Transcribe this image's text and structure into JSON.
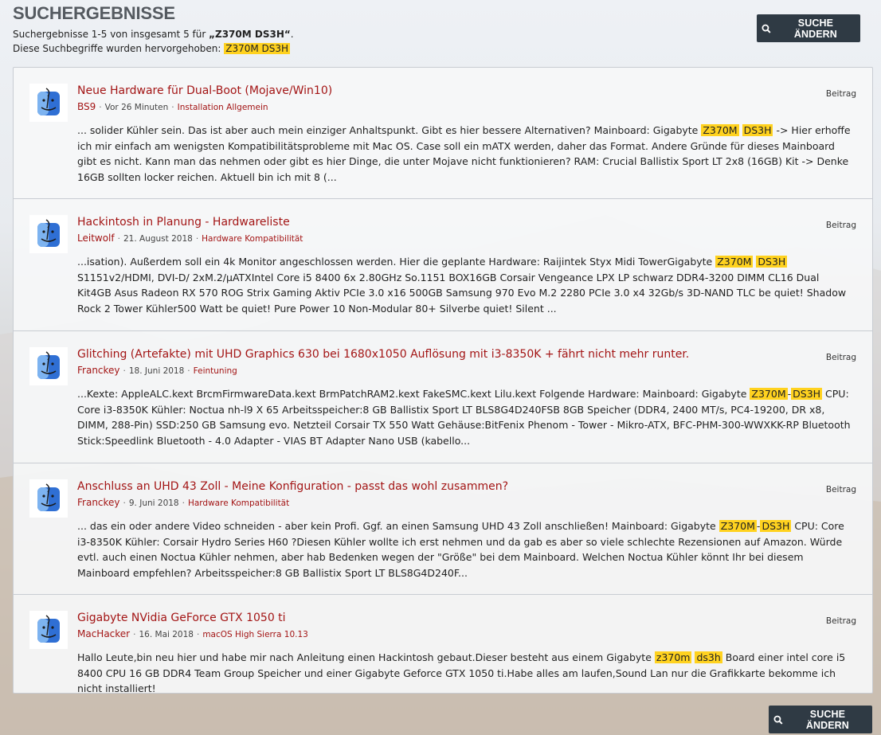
{
  "header": {
    "title": "SUCHERGEBNISSE",
    "summary_prefix": "Suchergebnisse 1-5 von insgesamt 5 für ",
    "query": "„Z370M DS3H“",
    "summary_suffix": ".",
    "highlight_label": "Diese Suchbegriffe wurden hervorgehoben: ",
    "highlight_term": "Z370M DS3H"
  },
  "buttons": {
    "change_search": "SUCHE ÄNDERN"
  },
  "results": [
    {
      "title": "Neue Hardware für Dual-Boot (Mojave/Win10)",
      "author": "BS9",
      "date": "Vor 26 Minuten",
      "forum": "Installation Allgemein",
      "type": "Beitrag",
      "snippet": [
        {
          "t": "... solider Kühler sein. Das ist aber auch mein einziger Anhaltspunkt. Gibt es hier bessere Alternativen? Mainboard: Gigabyte "
        },
        {
          "t": "Z370M",
          "hl": true
        },
        {
          "t": " "
        },
        {
          "t": "DS3H",
          "hl": true
        },
        {
          "t": " -> Hier erhoffe ich mir einfach am wenigsten Kompatibilitätsprobleme mit Mac OS. Case soll ein mATX werden, daher das Format. Andere Gründe für dieses Mainboard gibt es nicht. Kann man das nehmen oder gibt es hier Dinge, die unter Mojave nicht funktionieren? RAM: Crucial Ballistix Sport LT 2x8 (16GB) Kit -> Denke 16GB sollten locker reichen. Aktuell bin ich mit 8 (..."
        }
      ]
    },
    {
      "title": "Hackintosh in Planung - Hardwareliste",
      "author": "Leitwolf",
      "date": "21. August 2018",
      "forum": "Hardware Kompatibilität",
      "type": "Beitrag",
      "snippet": [
        {
          "t": "...isation). Außerdem soll ein 4k Monitor angeschlossen werden. Hier die geplante Hardware: Raijintek Styx Midi TowerGigabyte "
        },
        {
          "t": "Z370M",
          "hl": true
        },
        {
          "t": " "
        },
        {
          "t": "DS3H",
          "hl": true
        },
        {
          "t": " S1151v2/HDMI, DVI-D/ 2xM.2/µATXIntel Core i5 8400 6x 2.80GHz So.1151 BOX16GB Corsair Vengeance LPX LP schwarz DDR4-3200 DIMM CL16 Dual Kit4GB Asus Radeon RX 570 ROG Strix Gaming Aktiv PCIe 3.0 x16 500GB Samsung 970 Evo M.2 2280 PCIe 3.0 x4 32Gb/s 3D-NAND TLC be quiet! Shadow Rock 2 Tower Kühler500 Watt be quiet! Pure Power 10 Non-Modular 80+ Silverbe quiet! Silent ..."
        }
      ]
    },
    {
      "title": "Glitching (Artefakte) mit UHD Graphics 630 bei 1680x1050 Auflösung mit i3-8350K + fährt nicht mehr runter.",
      "author": "Franckey",
      "date": "18. Juni 2018",
      "forum": "Feintuning",
      "type": "Beitrag",
      "snippet": [
        {
          "t": "...Kexte: AppleALC.kext BrcmFirmwareData.kext BrmPatchRAM2.kext FakeSMC.kext Lilu.kext Folgende Hardware: Mainboard: Gigabyte "
        },
        {
          "t": "Z370M",
          "hl": true
        },
        {
          "t": "-"
        },
        {
          "t": "DS3H",
          "hl": true
        },
        {
          "t": " CPU: Core i3-8350K Kühler: Noctua nh-l9 X 65 Arbeitsspeicher:8 GB Ballistix Sport LT BLS8G4D240FSB 8GB Speicher (DDR4, 2400 MT/s, PC4-19200, DR x8, DIMM, 288-Pin) SSD:250 GB Samsung evo. Netzteil Corsair TX 550 Watt Gehäuse:BitFenix Phenom - Tower - Mikro-ATX, BFC-PHM-300-WWXKK-RP Bluetooth Stick:Speedlink Bluetooth - 4.0 Adapter - VIAS BT Adapter Nano USB (kabello..."
        }
      ]
    },
    {
      "title": "Anschluss an UHD 43 Zoll - Meine Konfiguration - passt das wohl zusammen?",
      "author": "Franckey",
      "date": "9. Juni 2018",
      "forum": "Hardware Kompatibilität",
      "type": "Beitrag",
      "snippet": [
        {
          "t": "... das ein oder andere Video schneiden - aber kein Profi. Ggf. an einen Samsung UHD 43 Zoll anschließen! Mainboard: Gigabyte "
        },
        {
          "t": "Z370M",
          "hl": true
        },
        {
          "t": "-"
        },
        {
          "t": "DS3H",
          "hl": true
        },
        {
          "t": " CPU: Core i3-8350K Kühler: Corsair Hydro Series H60 ?Diesen Kühler wollte ich erst nehmen und da gab es aber so viele schlechte Rezensionen auf Amazon. Würde evtl. auch einen Noctua Kühler nehmen, aber hab Bedenken wegen der \"Größe\" bei dem Mainboard. Welchen Noctua Kühler könnt Ihr bei diesem Mainboard empfehlen? Arbeitsspeicher:8 GB Ballistix Sport LT BLS8G4D240F..."
        }
      ]
    },
    {
      "title": "Gigabyte NVidia GeForce GTX 1050 ti",
      "author": "MacHacker",
      "date": "16. Mai 2018",
      "forum": "macOS High Sierra 10.13",
      "type": "Beitrag",
      "snippet": [
        {
          "t": "Hallo Leute,bin neu hier und habe mir nach Anleitung einen Hackintosh gebaut.Dieser besteht aus einem Gigabyte "
        },
        {
          "t": "z370m",
          "hl": true
        },
        {
          "t": " "
        },
        {
          "t": "ds3h",
          "hl": true
        },
        {
          "t": " Board einer intel core i5 8400 CPU 16 GB DDR4 Team Group Speicher und einer Gigabyte Geforce GTX 1050 ti.Habe alles am laufen,Sound Lan nur die Grafikkarte bekomme ich nicht installiert!"
        }
      ]
    }
  ]
}
